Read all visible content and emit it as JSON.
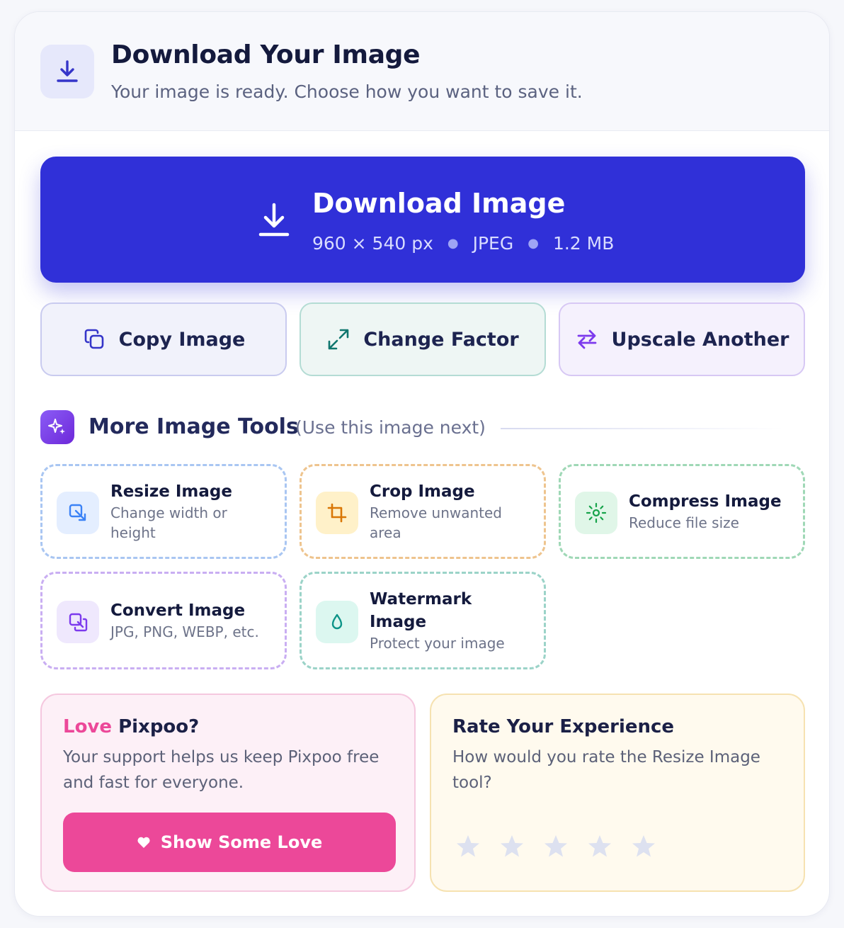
{
  "header": {
    "icon": "download-icon",
    "title": "Download Your Image",
    "subtitle": "Your image is ready. Choose how you want to save it."
  },
  "download": {
    "label": "Download Image",
    "dimensions": "960 × 540 px",
    "format": "JPEG",
    "size": "1.2 MB",
    "color": "#3030d8"
  },
  "actions": {
    "copy": "Copy Image",
    "factor": "Change Factor",
    "upscale": "Upscale Another"
  },
  "tools_section": {
    "title": "More Image Tools",
    "note": "(Use this image next)",
    "tools": [
      {
        "title": "Resize Image",
        "desc": "Change width or height",
        "icon": "resize-icon",
        "color": "#3b82f6"
      },
      {
        "title": "Crop Image",
        "desc": "Remove unwanted area",
        "icon": "crop-icon",
        "color": "#d97706"
      },
      {
        "title": "Compress Image",
        "desc": "Reduce file size",
        "icon": "compress-icon",
        "color": "#16a34a"
      },
      {
        "title": "Convert Image",
        "desc": "JPG, PNG, WEBP, etc.",
        "icon": "convert-icon",
        "color": "#7c3aed"
      },
      {
        "title": "Watermark Image",
        "desc": "Protect your image",
        "icon": "watermark-icon",
        "color": "#0d9488"
      }
    ]
  },
  "support": {
    "title_love": "Love",
    "title_brand": "Pixpoo?",
    "text": "Your support helps us keep Pixpoo free and fast for everyone.",
    "button": "Show Some Love",
    "color": "#ec4899"
  },
  "rating": {
    "title": "Rate Your Experience",
    "text": "How would you rate the Resize Image tool?",
    "stars_total": 5,
    "stars_filled": 0
  }
}
